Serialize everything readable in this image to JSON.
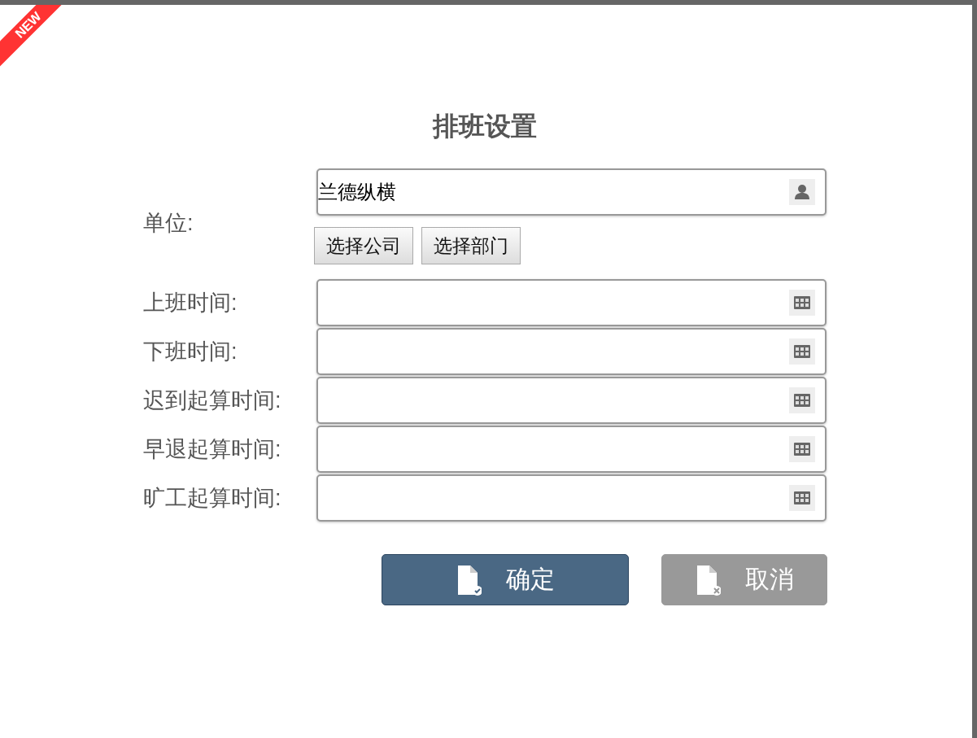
{
  "badge": "NEW",
  "title": "排班设置",
  "unit": {
    "label": "单位:",
    "value": "兰德纵横",
    "buttons": [
      "选择公司",
      "选择部门"
    ]
  },
  "time_fields": [
    {
      "label": "上班时间:"
    },
    {
      "label": "下班时间:"
    },
    {
      "label": "迟到起算时间:"
    },
    {
      "label": "早退起算时间:"
    },
    {
      "label": "旷工起算时间:"
    }
  ],
  "actions": [
    {
      "label": "确定",
      "kind": "confirm"
    },
    {
      "label": "取消",
      "kind": "cancel"
    }
  ]
}
